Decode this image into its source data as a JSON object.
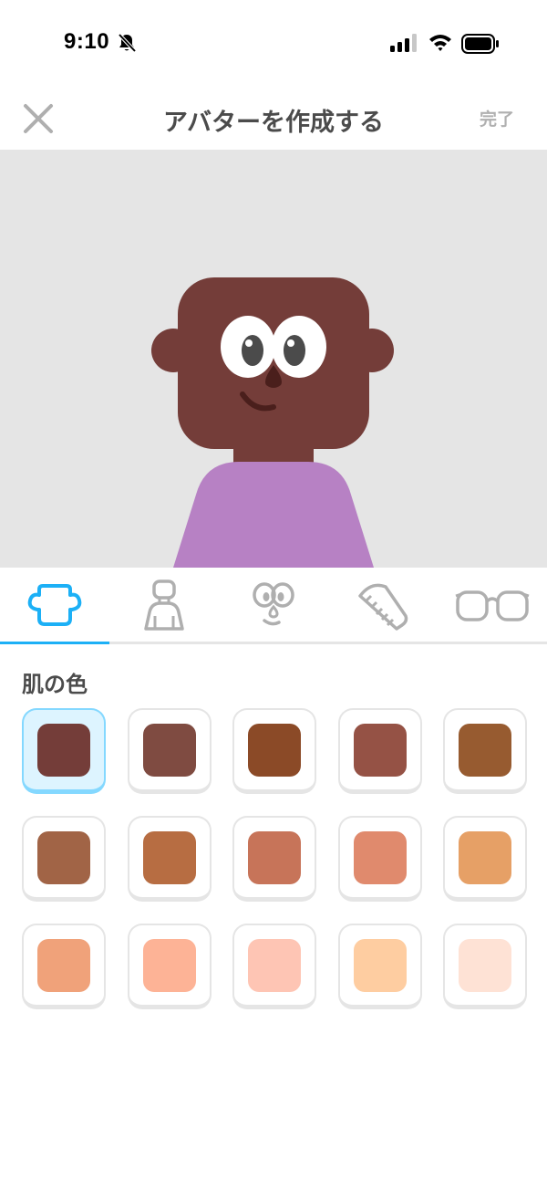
{
  "status": {
    "time": "9:10"
  },
  "header": {
    "title": "アバターを作成する",
    "done_label": "完了"
  },
  "tabs": [
    {
      "name": "skin",
      "icon": "head-shape-icon",
      "active": true
    },
    {
      "name": "body",
      "icon": "body-icon",
      "active": false
    },
    {
      "name": "face",
      "icon": "face-icon",
      "active": false
    },
    {
      "name": "hair",
      "icon": "comb-icon",
      "active": false
    },
    {
      "name": "glasses",
      "icon": "glasses-icon",
      "active": false
    }
  ],
  "section": {
    "title": "肌の色"
  },
  "swatches": [
    "#743d39",
    "#7f4b41",
    "#8b4a27",
    "#955245",
    "#975b30",
    "#a16446",
    "#b76d42",
    "#c77459",
    "#e08a6d",
    "#e6a066",
    "#f0a27a",
    "#fdb396",
    "#fec5b4",
    "#fecda1",
    "#fee2d5"
  ],
  "selected_swatch": 0,
  "avatar": {
    "skin": "#743d39",
    "shirt": "#b781c4",
    "background": "#e5e5e5"
  },
  "colors": {
    "accent": "#1cb0f6",
    "selected_bg": "#ddf4ff",
    "selected_border": "#84d8ff"
  }
}
